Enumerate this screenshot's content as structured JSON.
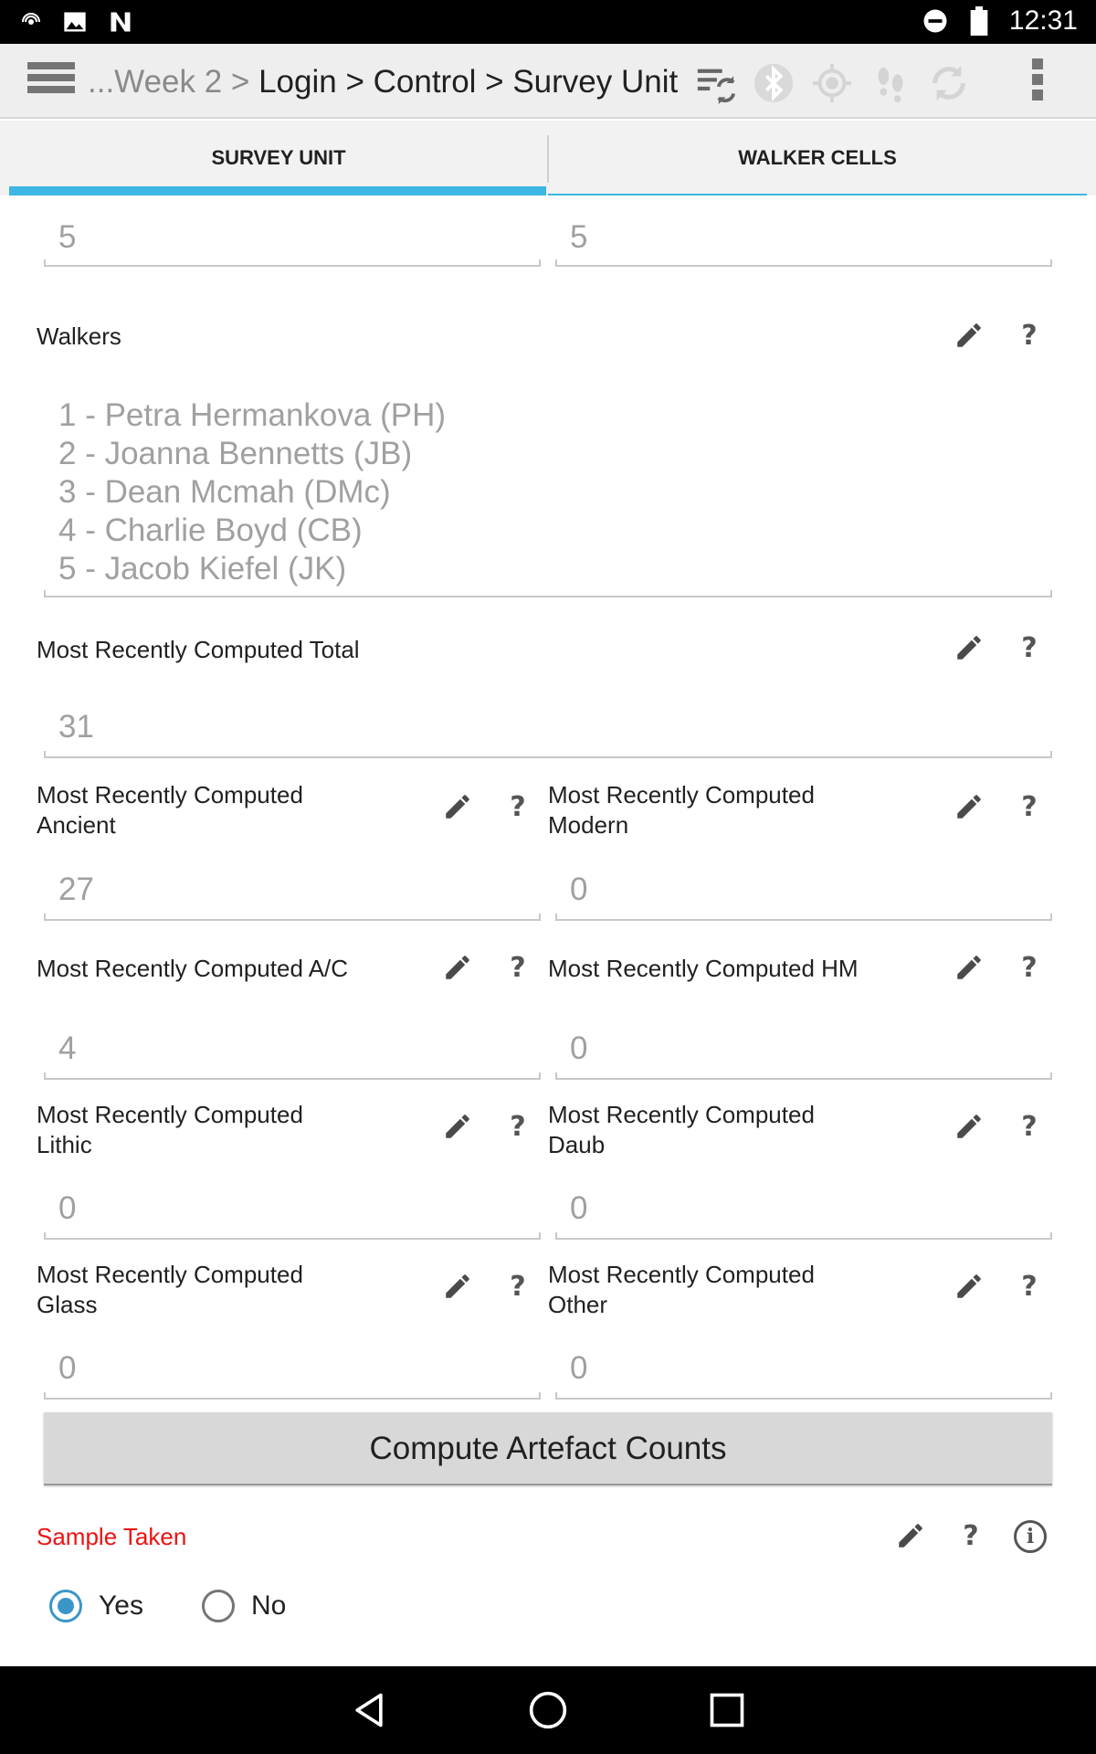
{
  "status_bar": {
    "time": "12:31",
    "left_icons": [
      "hotspot-icon",
      "image-icon",
      "n-app-icon"
    ],
    "right_icons": [
      "do-not-disturb-icon",
      "battery-icon"
    ]
  },
  "action_bar": {
    "breadcrumb_prefix": "...Week 2 > ",
    "breadcrumb_main": "Login > Control > Survey Unit",
    "icons": [
      "sync-list-icon",
      "bluetooth-icon",
      "gps-icon",
      "footsteps-icon",
      "refresh-icon"
    ]
  },
  "tabs": [
    {
      "label": "SURVEY UNIT",
      "selected": true
    },
    {
      "label": "WALKER CELLS",
      "selected": false
    }
  ],
  "form": {
    "top_fields": {
      "left_value": "5",
      "right_value": "5"
    },
    "walkers": {
      "label": "Walkers",
      "items": [
        "1 - Petra Hermankova (PH)",
        "2 - Joanna Bennetts (JB)",
        "3 - Dean Mcmah (DMc)",
        "4 - Charlie Boyd (CB)",
        "5 - Jacob Kiefel (JK)"
      ]
    },
    "total": {
      "label": "Most Recently Computed Total",
      "value": "31"
    },
    "ancient": {
      "label_line1": "Most Recently Computed",
      "label_line2": "Ancient",
      "value": "27"
    },
    "modern": {
      "label_line1": "Most Recently Computed",
      "label_line2": "Modern",
      "value": "0"
    },
    "ac": {
      "label": "Most Recently Computed A/C",
      "value": "4"
    },
    "hm": {
      "label": "Most Recently Computed HM",
      "value": "0"
    },
    "lithic": {
      "label_line1": "Most Recently Computed",
      "label_line2": "Lithic",
      "value": "0"
    },
    "daub": {
      "label_line1": "Most Recently Computed",
      "label_line2": "Daub",
      "value": "0"
    },
    "glass": {
      "label_line1": "Most Recently Computed",
      "label_line2": "Glass",
      "value": "0"
    },
    "other": {
      "label_line1": "Most Recently Computed",
      "label_line2": "Other",
      "value": "0"
    },
    "compute_button": "Compute Artefact Counts",
    "sample_taken": {
      "label": "Sample Taken",
      "options": [
        {
          "label": "Yes",
          "checked": true
        },
        {
          "label": "No",
          "checked": false
        }
      ]
    },
    "help_glyph": "?",
    "info_glyph": "i"
  },
  "colors": {
    "accent": "#3db7e4",
    "radio": "#3a96c8",
    "required_label": "#ee1111",
    "value_text": "#a0a0a0"
  }
}
